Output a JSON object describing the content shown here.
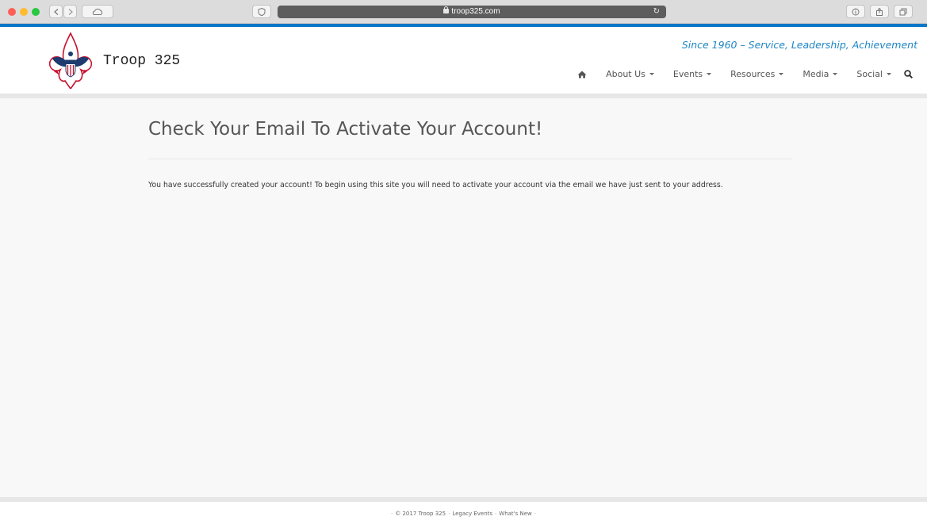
{
  "browser": {
    "url": "troop325.com"
  },
  "header": {
    "brand": "Troop 325",
    "tagline": "Since 1960 – Service, Leadership, Achievement"
  },
  "nav": {
    "items": [
      {
        "label": "About Us"
      },
      {
        "label": "Events"
      },
      {
        "label": "Resources"
      },
      {
        "label": "Media"
      },
      {
        "label": "Social"
      }
    ],
    "icons": [
      "home-icon",
      "search-icon"
    ]
  },
  "main": {
    "title": "Check Your Email To Activate Your Account!",
    "message": "You have successfully created your account! To begin using this site you will need to activate your account via the email we have just sent to your address."
  },
  "footer": {
    "copyright": "© 2017 Troop 325",
    "link1": "Legacy Events",
    "link2": "What's New"
  },
  "colors": {
    "accent": "#0a77c9",
    "tagline": "#1e86c5"
  }
}
